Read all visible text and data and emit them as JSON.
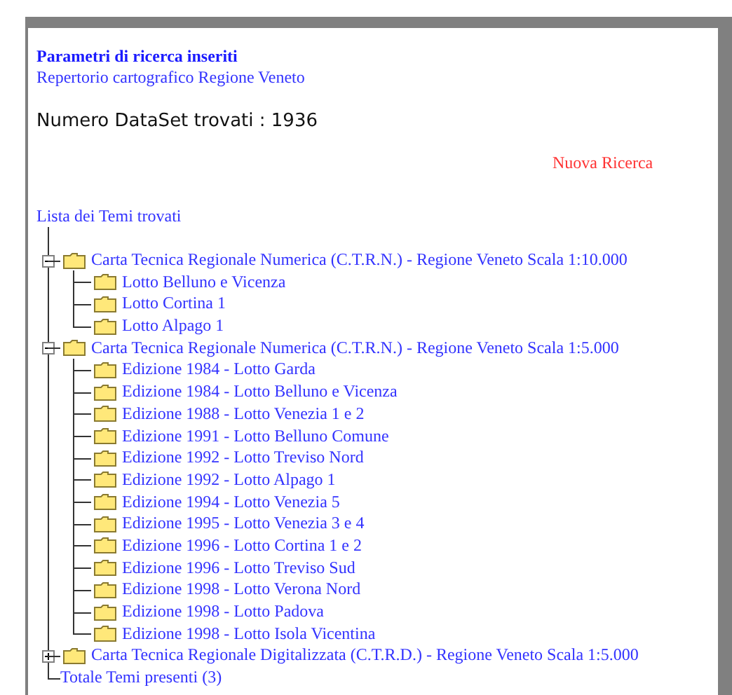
{
  "search_params": {
    "title": "Parametri di ricerca inseriti",
    "value": "Repertorio cartografico Regione Veneto"
  },
  "result_count": "Numero DataSet trovati : 1936",
  "new_search_link": "Nuova Ricerca",
  "tree": {
    "label": "Lista dei Temi trovati",
    "items": [
      {
        "label": "Carta Tecnica Regionale Numerica (C.T.R.N.) - Regione Veneto Scala 1:10.000",
        "expanded": true,
        "children": [
          {
            "label": "Lotto Belluno e Vicenza"
          },
          {
            "label": "Lotto Cortina 1"
          },
          {
            "label": "Lotto Alpago 1"
          }
        ]
      },
      {
        "label": "Carta Tecnica Regionale Numerica (C.T.R.N.) - Regione Veneto Scala 1:5.000",
        "expanded": true,
        "children": [
          {
            "label": "Edizione 1984 - Lotto Garda"
          },
          {
            "label": "Edizione 1984 - Lotto Belluno e Vicenza"
          },
          {
            "label": "Edizione 1988 - Lotto Venezia 1 e 2"
          },
          {
            "label": "Edizione 1991 - Lotto Belluno Comune"
          },
          {
            "label": "Edizione 1992 - Lotto Treviso Nord"
          },
          {
            "label": "Edizione 1992 - Lotto Alpago 1"
          },
          {
            "label": "Edizione 1994 - Lotto Venezia 5"
          },
          {
            "label": "Edizione 1995 - Lotto Venezia 3 e 4"
          },
          {
            "label": "Edizione 1996 - Lotto Cortina 1 e 2"
          },
          {
            "label": "Edizione 1996 - Lotto Treviso Sud"
          },
          {
            "label": "Edizione 1998 - Lotto Verona Nord"
          },
          {
            "label": "Edizione 1998 - Lotto Padova"
          },
          {
            "label": "Edizione 1998 - Lotto Isola Vicentina"
          }
        ]
      },
      {
        "label": "Carta Tecnica Regionale Digitalizzata (C.T.R.D.) - Regione Veneto Scala 1:5.000",
        "expanded": false
      }
    ],
    "total": "Totale Temi presenti (3)"
  }
}
